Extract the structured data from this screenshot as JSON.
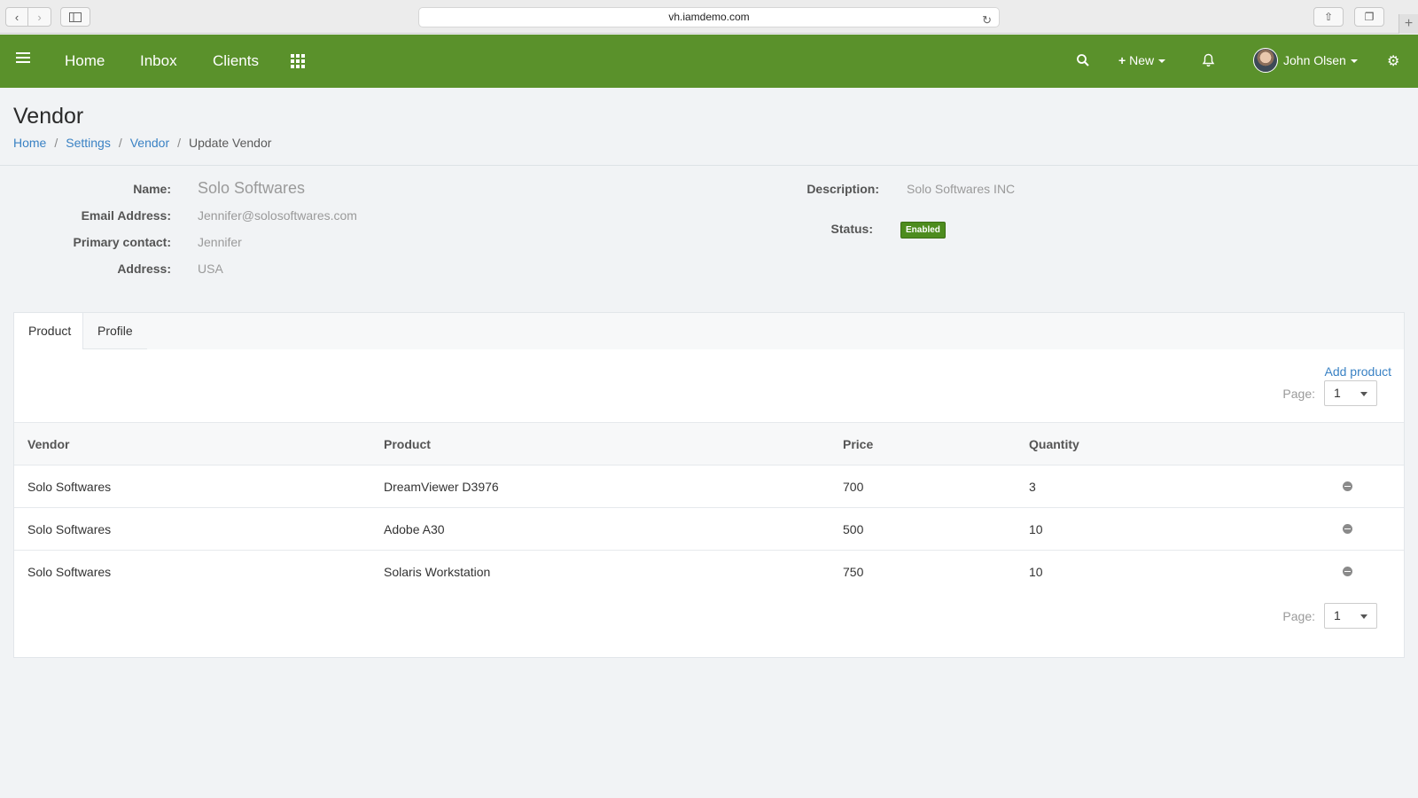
{
  "browser": {
    "url": "vh.iamdemo.com"
  },
  "header": {
    "nav": [
      "Home",
      "Inbox",
      "Clients"
    ],
    "new_label": "New",
    "user_name": "John Olsen",
    "brand_color": "#5a912b"
  },
  "page": {
    "title": "Vendor",
    "breadcrumb": [
      "Home",
      "Settings",
      "Vendor",
      "Update Vendor"
    ]
  },
  "vendor": {
    "labels": {
      "name": "Name:",
      "email": "Email Address:",
      "contact": "Primary contact:",
      "address": "Address:",
      "description": "Description:",
      "status": "Status:"
    },
    "name": "Solo Softwares",
    "email": "Jennifer@solosoftwares.com",
    "contact": "Jennifer",
    "address": "USA",
    "description": "Solo Softwares INC",
    "status": "Enabled"
  },
  "tabs": [
    "Product",
    "Profile"
  ],
  "products": {
    "add_label": "Add product",
    "page_label": "Page:",
    "page_value": "1",
    "columns": [
      "Vendor",
      "Product",
      "Price",
      "Quantity"
    ],
    "rows": [
      {
        "vendor": "Solo Softwares",
        "product": "DreamViewer D3976",
        "price": "700",
        "quantity": "3"
      },
      {
        "vendor": "Solo Softwares",
        "product": "Adobe A30",
        "price": "500",
        "quantity": "10"
      },
      {
        "vendor": "Solo Softwares",
        "product": "Solaris Workstation",
        "price": "750",
        "quantity": "10"
      }
    ]
  }
}
